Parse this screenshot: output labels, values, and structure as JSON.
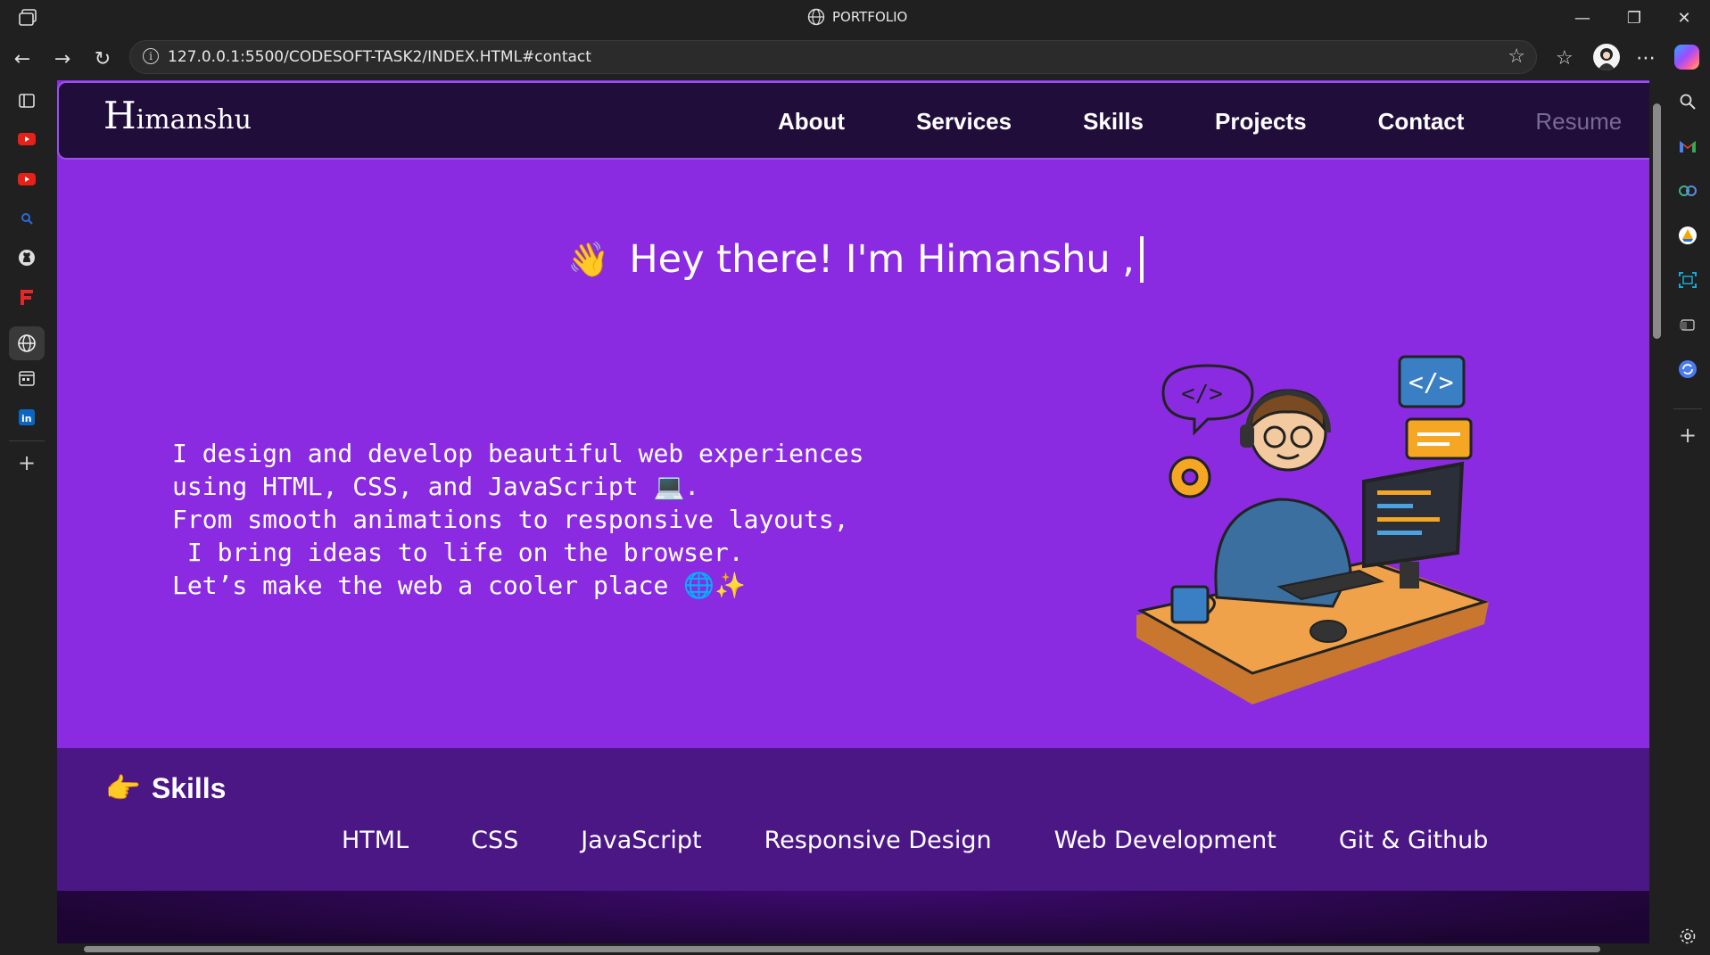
{
  "browser": {
    "tab_title": "PORTFOLIO",
    "url": "127.0.0.1:5500/CODESOFT-TASK2/INDEX.HTML#contact",
    "icons": [
      "workspaces-icon",
      "back-icon",
      "forward-icon",
      "refresh-icon",
      "info-icon",
      "favorite-star-icon",
      "favorites-icon",
      "profile-avatar",
      "more-icon",
      "copilot-icon"
    ]
  },
  "sidebar_left": {
    "items": [
      "tab-actions-icon",
      "youtube-icon",
      "youtube-icon",
      "search-icon",
      "github-icon",
      "flipkart-icon",
      "globe-icon",
      "calendar-icon",
      "linkedin-icon",
      "add-icon"
    ]
  },
  "sidebar_right": {
    "items": [
      "search-icon",
      "gmail-icon",
      "shopping-icon",
      "drive-icon",
      "screenshot-icon",
      "outlook-icon",
      "refresh-circle-icon",
      "add-icon",
      "settings-icon"
    ]
  },
  "site": {
    "brand_first": "H",
    "brand_rest": "imanshu",
    "nav": [
      "About",
      "Services",
      "Skills",
      "Projects",
      "Contact",
      "Resume"
    ],
    "greeting_emoji": "👋",
    "greeting": "Hey there! I'm Himanshu ,",
    "intro": "I design and develop beautiful web experiences\nusing HTML, CSS, and JavaScript 💻.\nFrom smooth animations to responsive layouts,\n I bring ideas to life on the browser.\nLet’s make the web a cooler place 🌐✨",
    "skills_emoji": "👉",
    "skills_heading": "Skills",
    "skills": [
      "HTML",
      "CSS",
      "JavaScript",
      "Responsive Design",
      "Web Development",
      "Git & Github"
    ]
  },
  "colors": {
    "hero_bg": "#8a2be2",
    "nav_bg": "#200d3a",
    "skills_bg": "#4a1785"
  }
}
